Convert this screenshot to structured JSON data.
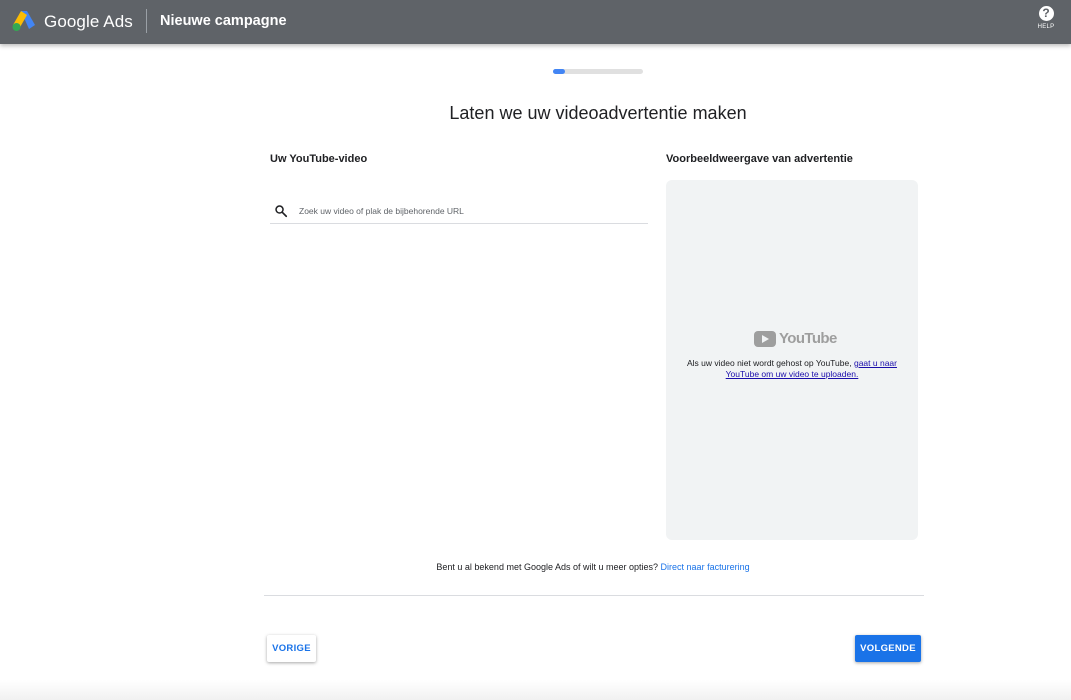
{
  "header": {
    "brand": "Google Ads",
    "campaign_title": "Nieuwe campagne",
    "help_label": "HELP",
    "help_icon": "?",
    "background_color": "#5f6368"
  },
  "progress": {
    "fraction": 0.13,
    "fill_color": "#4285f4",
    "track_color": "#e0e0e0"
  },
  "main": {
    "heading": "Laten we uw videoadvertentie maken",
    "left_title": "Uw YouTube-video",
    "search": {
      "placeholder": "Zoek uw video of plak de bijbehorende URL",
      "value": ""
    },
    "right_title": "Voorbeeldweergave van advertentie",
    "preview": {
      "logo_text": "YouTube",
      "text": "Als uw video niet wordt gehost op YouTube, ",
      "link": "gaat u naar YouTube om uw video te uploaden."
    }
  },
  "footer": {
    "billing_text": "Bent u al bekend met Google Ads of wilt u meer opties?",
    "billing_link": "Direct naar facturering",
    "prev_label": "VORIGE",
    "next_label": "VOLGENDE",
    "accent_color": "#1a73e8"
  }
}
